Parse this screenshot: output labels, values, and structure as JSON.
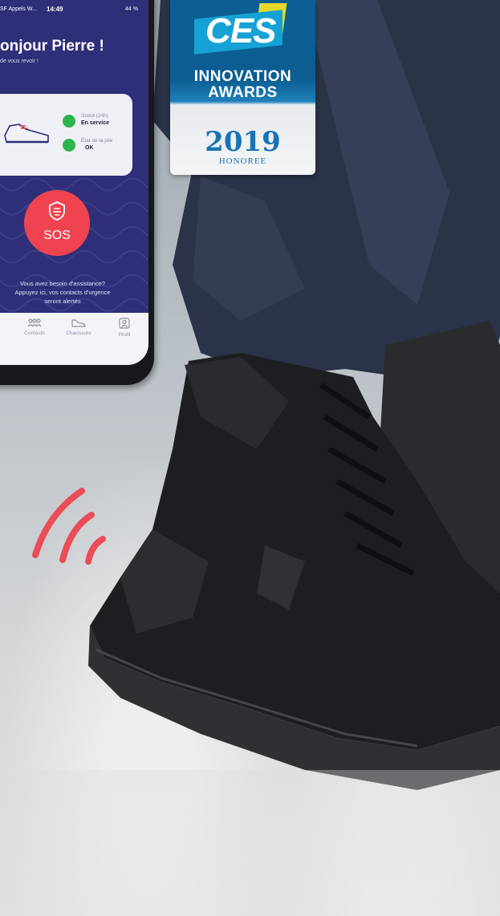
{
  "badge": {
    "logo": "CES",
    "line1": "INNOVATION",
    "line2": "AWARDS",
    "year": "2019",
    "status": "HONOREE"
  },
  "phone": {
    "status_bar": {
      "carrier": "SF Appels W...",
      "time": "14:49",
      "battery": "44 %"
    },
    "greeting": "onjour Pierre !",
    "subtitle": "de vous revoir !",
    "status_card": {
      "status_label": "Statut (24h)",
      "status_value": "En service",
      "battery_label": "État de la pile",
      "battery_value": "OK"
    },
    "sos_label": "SOS",
    "help_text": [
      "Vous avez besoin d'assistance?",
      "Appuyez ici, vos contacts d'urgence",
      "seront alertés"
    ],
    "tabs": [
      {
        "label": "Contacts",
        "icon": "contacts-icon"
      },
      {
        "label": "Chaussure",
        "icon": "shoe-icon"
      },
      {
        "label": "Profil",
        "icon": "profile-icon"
      }
    ]
  },
  "colors": {
    "screen_bg": "#2e2f78",
    "sos_red": "#ef4350",
    "ok_green": "#2bb44a",
    "ces_blue": "#0b5d92"
  }
}
